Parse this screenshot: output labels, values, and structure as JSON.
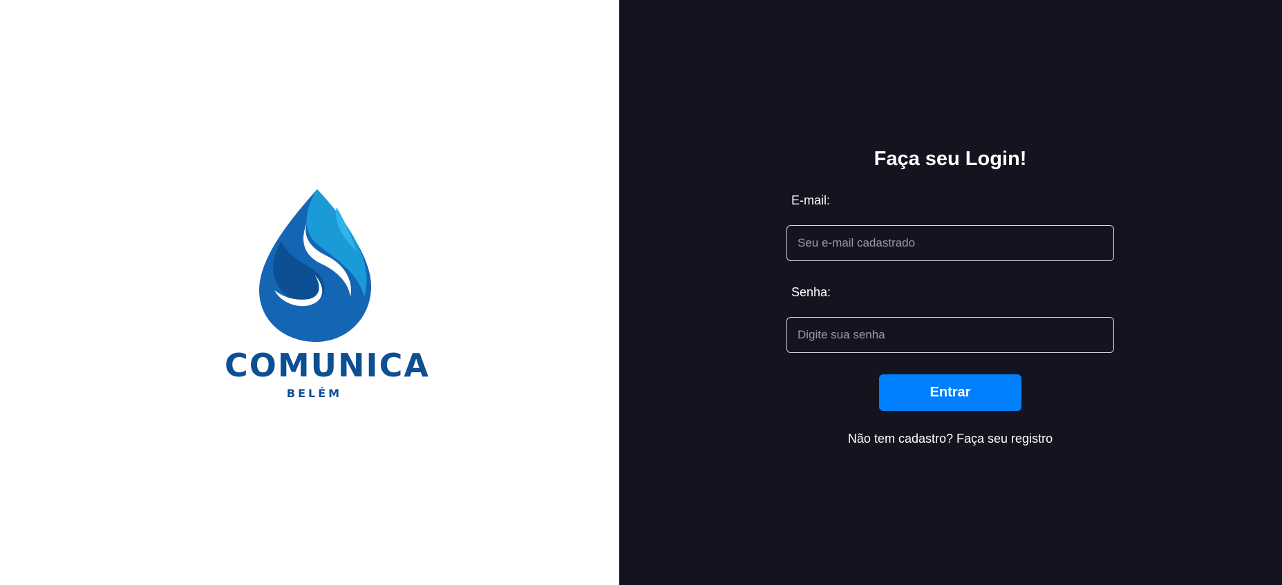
{
  "brand": {
    "name": "COMUNICA",
    "subtitle": "BELÉM",
    "logo_icon": "water-drop-icon",
    "colors": {
      "primary": "#0d4f93",
      "light": "#1a9ad6",
      "mid": "#1565b5"
    }
  },
  "login": {
    "title": "Faça seu Login!",
    "email_label": "E-mail:",
    "email_placeholder": "Seu e-mail cadastrado",
    "email_value": "",
    "password_label": "Senha:",
    "password_placeholder": "Digite sua senha",
    "password_value": "",
    "submit_label": "Entrar",
    "register_prompt": "Não tem cadastro?",
    "register_link": "Faça seu registro",
    "colors": {
      "background": "#13141f",
      "button": "#0080ff"
    }
  }
}
